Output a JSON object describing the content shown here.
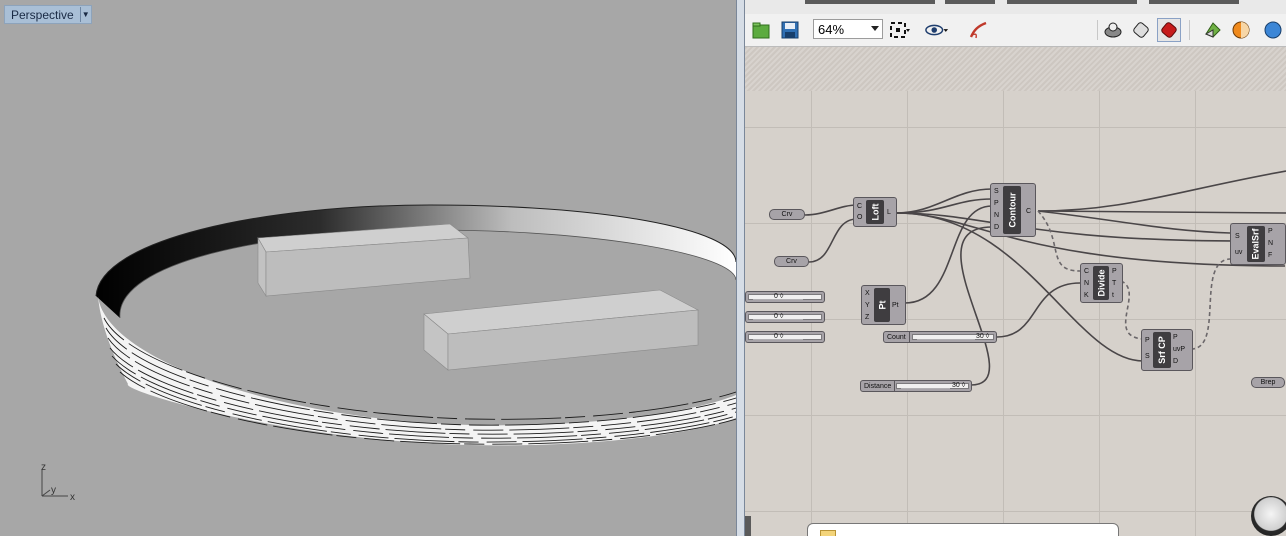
{
  "viewport": {
    "label": "Perspective",
    "axes": {
      "z": "z",
      "y": "y",
      "x": "x"
    }
  },
  "toolbar": {
    "zoom": "64%",
    "icons": [
      "open-file-icon",
      "save-icon",
      "zoom-extents-icon",
      "preview-eye-icon",
      "sketch-icon",
      "preview-wireframe-icon",
      "preview-shaded-icon",
      "preview-selected-icon",
      "bake-icon",
      "material-icon",
      "globe-icon"
    ]
  },
  "canvas": {
    "params": {
      "crv1": "Crv",
      "crv2": "Crv",
      "brep": "Brep"
    },
    "sliders": [
      {
        "label": "",
        "value": "0"
      },
      {
        "label": "",
        "value": "0"
      },
      {
        "label": "",
        "value": "0"
      },
      {
        "label": "Count",
        "value": "30"
      },
      {
        "label": "Distance",
        "value": "30"
      }
    ],
    "components": {
      "loft": {
        "name": "Loft",
        "inputs": [
          "C",
          "O"
        ],
        "outputs": [
          "L"
        ]
      },
      "pt": {
        "name": "Pt",
        "inputs": [
          "X",
          "Y",
          "Z"
        ],
        "outputs": [
          "Pt"
        ]
      },
      "contour": {
        "name": "Contour",
        "inputs": [
          "S",
          "P",
          "N",
          "D"
        ],
        "outputs": [
          "C"
        ]
      },
      "divide": {
        "name": "Divide",
        "inputs": [
          "C",
          "N",
          "K"
        ],
        "outputs": [
          "P",
          "T",
          "t"
        ]
      },
      "srfcp": {
        "name": "Srf CP",
        "inputs": [
          "P",
          "S"
        ],
        "outputs": [
          "P",
          "uvP",
          "D"
        ]
      },
      "evalsrf": {
        "name": "EvalSrf",
        "inputs": [
          "S",
          "uv"
        ],
        "outputs": [
          "P",
          "N",
          "F"
        ]
      }
    }
  }
}
